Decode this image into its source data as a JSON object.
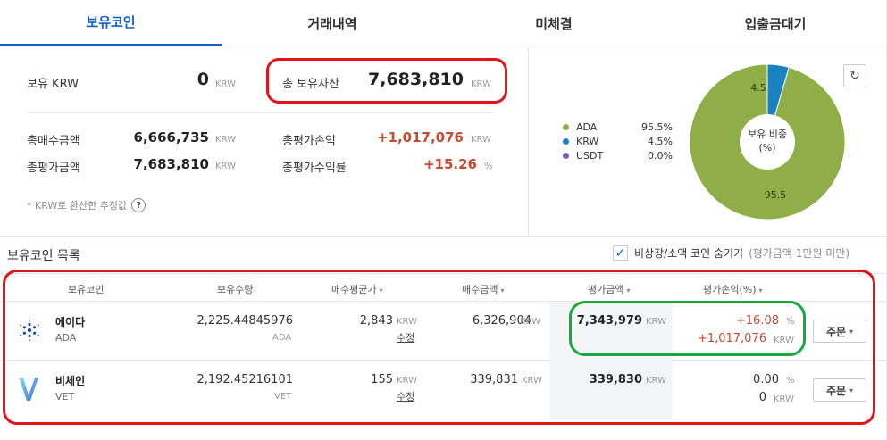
{
  "tabs": [
    "보유코인",
    "거래내역",
    "미체결",
    "입출금대기"
  ],
  "summary": {
    "krw_label": "보유 KRW",
    "krw_value": "0",
    "krw_unit": "KRW",
    "total_label": "총 보유자산",
    "total_value": "7,683,810",
    "total_unit": "KRW",
    "buy_label": "총매수금액",
    "buy_value": "6,666,735",
    "buy_unit": "KRW",
    "pnl_label": "총평가손익",
    "pnl_value": "+1,017,076",
    "pnl_unit": "KRW",
    "eval_label": "총평가금액",
    "eval_value": "7,683,810",
    "eval_unit": "KRW",
    "rate_label": "총평가수익률",
    "rate_value": "+15.26",
    "rate_unit": "%",
    "note": "* KRW로 환산한 추정값",
    "help": "?"
  },
  "chart_data": {
    "type": "pie",
    "donut": true,
    "title": "보유 비중",
    "center_sub": "(%)",
    "slices": [
      {
        "name": "ADA",
        "value": 95.5,
        "label": "95.5%",
        "color": "#8fae47"
      },
      {
        "name": "KRW",
        "value": 4.5,
        "label": "4.5%",
        "color": "#1a82c1"
      },
      {
        "name": "USDT",
        "value": 0.0,
        "label": "0.0%",
        "color": "#7b5ea7"
      }
    ],
    "data_labels": [
      "95.5",
      "4.5"
    ]
  },
  "refresh_icon": "↻",
  "list": {
    "title": "보유코인 목록",
    "hide_label": "비상장/소액 코인 숨기기",
    "hide_note": "(평가금액 1만원 미만)",
    "hide_checked": true,
    "check_icon": "✓",
    "headers": [
      "보유코인",
      "보유수량",
      "매수평균가",
      "매수금액",
      "평가금액",
      "평가손익(%)"
    ],
    "sort_arrow": "▾",
    "rows": [
      {
        "name": "에이다",
        "symbol": "ADA",
        "icon": "cardano-icon",
        "qty": "2,225.44845976",
        "qty_unit": "ADA",
        "avg": "2,843",
        "avg_unit": "KRW",
        "edit": "수정",
        "buy": "6,326,904",
        "buy_unit": "KRW",
        "eval": "7,343,979",
        "eval_unit": "KRW",
        "pct": "+16.08",
        "pct_unit": "%",
        "pnl": "+1,017,076",
        "pnl_unit": "KRW",
        "order": "주문"
      },
      {
        "name": "비체인",
        "symbol": "VET",
        "icon": "vechain-icon",
        "qty": "2,192.45216101",
        "qty_unit": "VET",
        "avg": "155",
        "avg_unit": "KRW",
        "edit": "수정",
        "buy": "339,831",
        "buy_unit": "KRW",
        "eval": "339,830",
        "eval_unit": "KRW",
        "pct": "0.00",
        "pct_unit": "%",
        "pnl": "0",
        "pnl_unit": "KRW",
        "order": "주문"
      }
    ]
  }
}
